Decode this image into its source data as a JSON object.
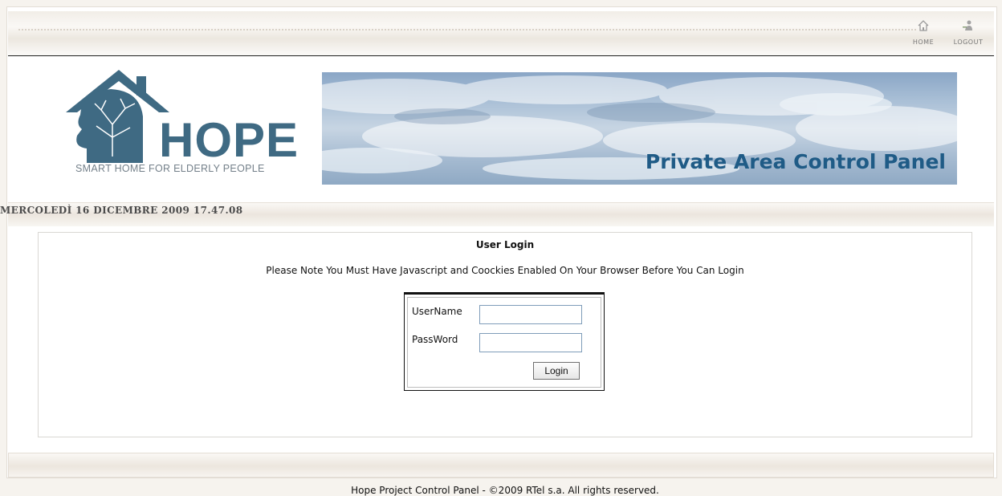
{
  "nav": {
    "home_label": "HOME",
    "logout_label": "LOGOUT"
  },
  "brand": {
    "name": "HOPE",
    "tagline": "SMART HOME FOR ELDERLY PEOPLE",
    "color": "#3f6a83"
  },
  "banner": {
    "title": "Private Area Control Panel",
    "title_color": "#1f5b86"
  },
  "datetime": "MERCOLEDÌ 16 DICEMBRE 2009 17.47.08",
  "login": {
    "title": "User Login",
    "note": "Please Note You Must Have Javascript and Coockies Enabled On Your Browser Before You Can Login",
    "username_label": "UserName",
    "username_value": "",
    "password_label": "PassWord",
    "password_value": "",
    "button_label": "Login"
  },
  "footer": "Hope Project Control Panel - ©2009 RTel s.a. All rights reserved."
}
